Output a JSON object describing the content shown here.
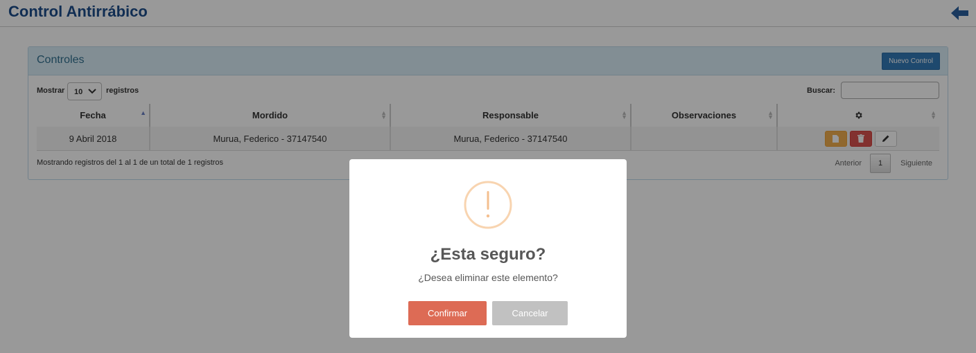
{
  "header": {
    "title": "Control Antirrábico",
    "back_icon": "arrow-left-icon"
  },
  "panel": {
    "title": "Controles",
    "new_button_label": "Nuevo Control",
    "length": {
      "prefix": "Mostrar",
      "value": "10",
      "suffix": "registros"
    },
    "search": {
      "label": "Buscar:",
      "value": ""
    }
  },
  "table": {
    "columns": [
      "Fecha",
      "Mordido",
      "Responsable",
      "Observaciones"
    ],
    "actions_header_icon": "gear-icon",
    "rows": [
      {
        "fecha": "9 Abril 2018",
        "mordido": "Murua, Federico - 37147540",
        "responsable": "Murua, Federico - 37147540",
        "observaciones": ""
      }
    ],
    "info": "Mostrando registros del 1 al 1 de un total de 1 registros",
    "pager": {
      "prev": "Anterior",
      "current": "1",
      "next": "Siguiente"
    }
  },
  "modal": {
    "icon": "warning-icon",
    "title": "¿Esta seguro?",
    "text": "¿Desea eliminar este elemento?",
    "confirm_label": "Confirmar",
    "cancel_label": "Cancelar"
  },
  "colors": {
    "title": "#1d4d8a",
    "primary": "#337ab7",
    "warning": "#f0ad4e",
    "danger": "#d9534f",
    "confirm": "#dd6b55",
    "cancel": "#c1c1c1"
  }
}
